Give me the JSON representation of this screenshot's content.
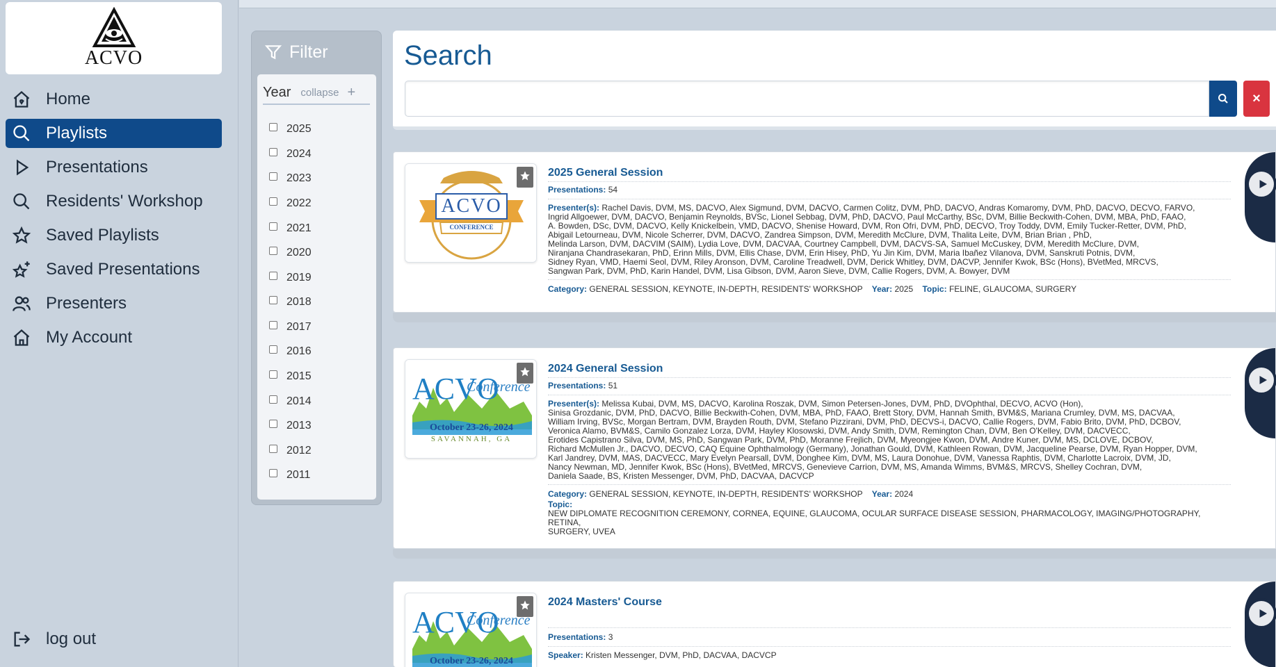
{
  "sidebar": {
    "logo_text": "ACVO",
    "items": [
      {
        "label": "Home",
        "icon": "home-icon"
      },
      {
        "label": "Playlists",
        "icon": "search-icon",
        "active": true
      },
      {
        "label": "Presentations",
        "icon": "play-icon"
      },
      {
        "label": "Residents' Workshop",
        "icon": "search-icon"
      },
      {
        "label": "Saved Playlists",
        "icon": "star-icon"
      },
      {
        "label": "Saved Presentations",
        "icon": "sparkle-star-icon"
      },
      {
        "label": "Presenters",
        "icon": "users-icon"
      },
      {
        "label": "My Account",
        "icon": "home-icon"
      }
    ],
    "logout_label": "log out"
  },
  "filter": {
    "title": "Filter",
    "group_label": "Year",
    "collapse_label": "collapse",
    "plus": "+",
    "years": [
      "2025",
      "2024",
      "2023",
      "2022",
      "2021",
      "2020",
      "2019",
      "2018",
      "2017",
      "2016",
      "2015",
      "2014",
      "2013",
      "2012",
      "2011"
    ]
  },
  "search": {
    "title": "Search",
    "value": "",
    "clear": "×"
  },
  "cards": [
    {
      "title": "2025 General Session",
      "thumb_text": "ACVO",
      "thumb_sub": "CONFERENCE",
      "presentations_label": "Presentations:",
      "presentations": "54",
      "presenters_label": "Presenter(s):",
      "presenter_lines": [
        "Rachel Davis, DVM, MS, DACVO,  Alex Sigmund, DVM, DACVO,  Carmen Colitz, DVM, PhD, DACVO,  Andras Komaromy, DVM, PhD, DACVO, DECVO, FARVO,",
        "Ingrid Allgoewer, DVM, DACVO,  Benjamin Reynolds, BVSc,  Lionel Sebbag, DVM, PhD, DACVO,  Paul McCarthy, BSc, DVM,  Billie Beckwith-Cohen, DVM, MBA, PhD, FAAO,",
        "A. Bowden, DSc, DVM, DACVO,  Kelly Knickelbein, VMD, DACVO,  Shenise Howard, DVM,  Ron Ofri, DVM, PhD, DECVO,  Troy Toddy, DVM,  Emily Tucker-Retter, DVM, PhD,",
        "Abigail Letourneau, DVM,  Nicole Scherrer, DVM, DACVO,  Zandrea Simpson, DVM,  Meredith McClure, DVM,  Thalita Leite, DVM,  Brian Brian , PhD,",
        "Melinda Larson, DVM, DACVIM (SAIM),  Lydia Love, DVM, DACVAA,  Courtney Campbell, DVM, DACVS-SA,  Samuel McCuskey, DVM,  Meredith McClure, DVM,",
        "Niranjana Chandrasekaran, PhD,  Erinn Mills, DVM,  Ellis Chase, DVM,  Erin Hisey, PhD,  Yu Jin Kim, DVM,  Maria Ibañez Vilanova, DVM,  Sanskruti Potnis, DVM,",
        "Sidney Ryan, VMD,  Haemi Seol, DVM,  Riley Aronson, DVM,  Caroline Treadwell, DVM,  Derick Whitley, DVM, DACVP,  Jennifer Kwok, BSc (Hons), BVetMed, MRCVS,",
        "Sangwan Park, DVM, PhD,  Karin Handel, DVM,  Lisa Gibson, DVM,  Aaron Sieve, DVM,  Callie Rogers, DVM,  A. Bowyer, DVM"
      ],
      "category_label": "Category:",
      "category": "GENERAL SESSION, KEYNOTE, IN-DEPTH, RESIDENTS' WORKSHOP",
      "year_label": "Year:",
      "year": "2025",
      "topic_label": "Topic:",
      "topic": "FELINE, GLAUCOMA, SURGERY"
    },
    {
      "title": "2024 General Session",
      "thumb_text": "ACVO",
      "thumb_script": "Conference",
      "thumb_date": "October 23-26, 2024",
      "thumb_city": "SAVANNAH, GA",
      "presentations_label": "Presentations:",
      "presentations": "51",
      "presenters_label": "Presenter(s):",
      "presenter_lines": [
        "Melissa Kubai, DVM, MS, DACVO,  Karolina Roszak, DVM,  Simon Petersen-Jones, DVM, PhD, DVOphthal, DECVO, ACVO (Hon),",
        "Sinisa Grozdanic, DVM, PhD, DACVO,  Billie Beckwith-Cohen, DVM, MBA, PhD, FAAO,  Brett Story, DVM,  Hannah Smith, BVM&S,  Mariana Crumley, DVM, MS, DACVAA,",
        "William Irving, BVSc,  Morgan Bertram, DVM,  Brayden Routh, DVM,  Stefano Pizzirani, DVM, PhD, DECVS-i, DACVO,  Callie Rogers, DVM,  Fabio Brito, DVM, PhD, DCBOV,",
        "Veronica Alamo, BVM&S,  Camilo Gonzalez Lorza, DVM,  Hayley Klosowski, DVM,  Andy Smith, DVM,  Remington Chan, DVM,  Ben O'Kelley, DVM, DACVECC,",
        "Erotides Capistrano Silva, DVM, MS, PhD,  Sangwan Park, DVM, PhD,  Moranne Frejlich, DVM,  Myeongjee Kwon, DVM,  Andre Kuner, DVM, MS, DCLOVE, DCBOV,",
        "Richard McMullen Jr., DACVO, DECVO, CAQ Equine Ophthalmology (Germany),  Jonathan Gould, DVM,  Kathleen Rowan, DVM,  Jacqueline Pearse, DVM,  Ryan Hopper, DVM,",
        "Karl Jandrey, DVM, MAS, DACVECC,  Mary Evelyn Pearsall, DVM,  Donghee Kim, DVM, MS,  Laura Donohue, DVM,  Vanessa Raphtis, DVM,  Charlotte Lacroix, DVM, JD,",
        "Nancy Newman, MD,  Jennifer Kwok, BSc (Hons), BVetMed, MRCVS,  Genevieve Carrion, DVM, MS,  Amanda Wimms, BVM&S, MRCVS,  Shelley Cochran, DVM,",
        "Daniela Saade, BS,  Kristen Messenger, DVM, PhD, DACVAA, DACVCP"
      ],
      "category_label": "Category:",
      "category": "GENERAL SESSION, KEYNOTE, IN-DEPTH, RESIDENTS' WORKSHOP",
      "year_label": "Year:",
      "year": "2024",
      "topic_label": "Topic:",
      "topic_lines": [
        "NEW DIPLOMATE RECOGNITION CEREMONY, CORNEA, EQUINE, GLAUCOMA, OCULAR SURFACE DISEASE SESSION, PHARMACOLOGY, IMAGING/PHOTOGRAPHY, RETINA,",
        "SURGERY, UVEA"
      ]
    },
    {
      "title": "2024 Masters' Course",
      "thumb_text": "ACVO",
      "thumb_script": "Conference",
      "thumb_date": "October 23-26, 2024",
      "presentations_label": "Presentations:",
      "presentations": "3",
      "speaker_label": "Speaker:",
      "speaker": "Kristen Messenger, DVM, PhD, DACVAA, DACVCP"
    }
  ],
  "colors": {
    "brand_blue": "#0f4a8a",
    "title_blue": "#175a93",
    "clear_red": "#d9343f",
    "sidebar_bg": "#c9d3de"
  }
}
